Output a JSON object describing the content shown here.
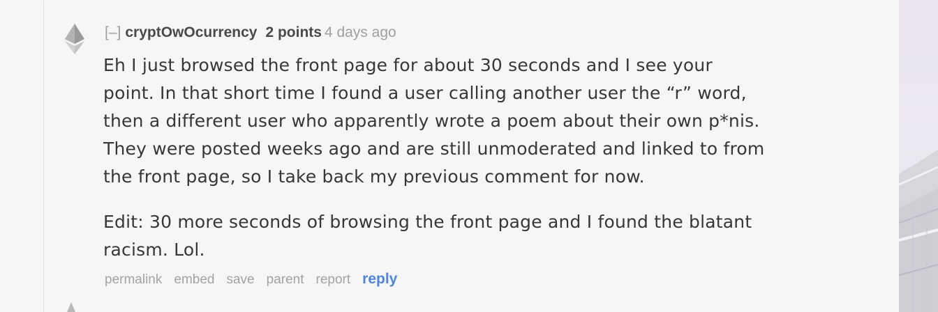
{
  "comment": {
    "expand_label": "[–]",
    "author": "cryptOwOcurrency",
    "score": "2 points",
    "age": "4 days ago",
    "paragraphs": [
      "Eh I just browsed the front page for about 30 seconds and I see your",
      "point. In that short time I found a user calling another user the “r” word,",
      "then a different user who apparently wrote a poem about their own p*nis.",
      "They were posted weeks ago and are still unmoderated and linked to from",
      "the front page, so I take back my previous comment for now."
    ],
    "edit_lines": [
      "Edit: 30 more seconds of browsing the front page and I found the blatant",
      "racism. Lol."
    ],
    "buttons": {
      "permalink": "permalink",
      "embed": "embed",
      "save": "save",
      "parent": "parent",
      "report": "report",
      "reply": "reply"
    },
    "vote_icon": "ethereum-diamond-icon"
  },
  "colors": {
    "background": "#f6f6f6",
    "text": "#373737",
    "meta": "#a0a0a0",
    "reply_link": "#4f86d8"
  }
}
